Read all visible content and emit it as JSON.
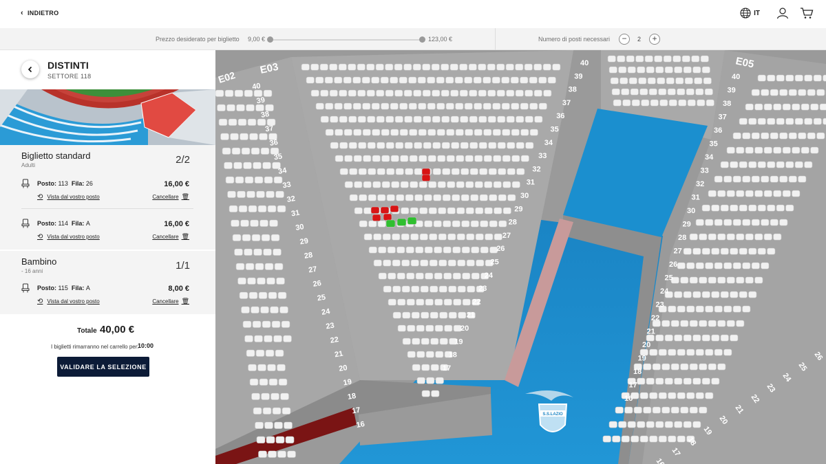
{
  "topbar": {
    "back_label": "INDIETRO",
    "lang": "IT"
  },
  "filters": {
    "price_label": "Prezzo desiderato per biglietto",
    "price_min": "9,00 €",
    "price_max": "123,00 €",
    "seats_label": "Numero di posti necessari",
    "seats_minus": "−",
    "seats_value": "2",
    "seats_plus": "+"
  },
  "sector": {
    "title": "DISTINTI",
    "subtitle": "SETTORE 118"
  },
  "groups": [
    {
      "title": "Biglietto standard",
      "sub": "Adulti",
      "count": "2/2",
      "seats": [
        {
          "posto_label": "Posto:",
          "posto": "113",
          "fila_label": "Fila:",
          "fila": "26",
          "price": "16,00 €",
          "view": "Vista dal vostro posto",
          "cancel": "Cancellare"
        },
        {
          "posto_label": "Posto:",
          "posto": "114",
          "fila_label": "Fila:",
          "fila": "A",
          "price": "16,00 €",
          "view": "Vista dal vostro posto",
          "cancel": "Cancellare"
        }
      ]
    },
    {
      "title": "Bambino",
      "sub": "- 16 anni",
      "count": "1/1",
      "seats": [
        {
          "posto_label": "Posto:",
          "posto": "115",
          "fila_label": "Fila:",
          "fila": "A",
          "price": "8,00 €",
          "view": "Vista dal vostro posto",
          "cancel": "Cancellare"
        }
      ]
    }
  ],
  "summary": {
    "total_label": "Totale",
    "total_value": "40,00 €",
    "cart_note": "I biglietti rimarranno nel carrello per:",
    "cart_time": "10:00",
    "validate_label": "VALIDARE LA SELEZIONE"
  },
  "map": {
    "sector_labels": [
      "E02",
      "E03",
      "E05"
    ],
    "left_rows": [
      "40",
      "39",
      "38",
      "37",
      "36",
      "35",
      "34",
      "33",
      "32",
      "31",
      "30",
      "29",
      "28",
      "27",
      "26",
      "25",
      "24",
      "23",
      "22",
      "21",
      "20",
      "19",
      "18",
      "17",
      "16"
    ],
    "mid_rows": [
      "40",
      "39",
      "38",
      "37",
      "36",
      "35",
      "34",
      "33",
      "32",
      "31",
      "30",
      "29",
      "28",
      "27",
      "26",
      "25",
      "24",
      "23",
      "22",
      "21",
      "20",
      "19",
      "18",
      "17"
    ],
    "right_rows": [
      "40",
      "39",
      "38",
      "37",
      "36",
      "35",
      "34",
      "33",
      "32",
      "31",
      "30",
      "29",
      "28",
      "27",
      "26",
      "25",
      "24",
      "23",
      "22",
      "21",
      "20",
      "19",
      "18",
      "17",
      "16"
    ],
    "far_rows": [
      "26",
      "25",
      "24",
      "23",
      "22",
      "21",
      "20",
      "19",
      "18",
      "17",
      "16"
    ],
    "crest_text": "S.S.LAZIO",
    "colors": {
      "selected": "#2fbf2f",
      "taken": "#d81414",
      "pitch": "#1e8fd0",
      "seat": "#f1f1f1"
    }
  }
}
